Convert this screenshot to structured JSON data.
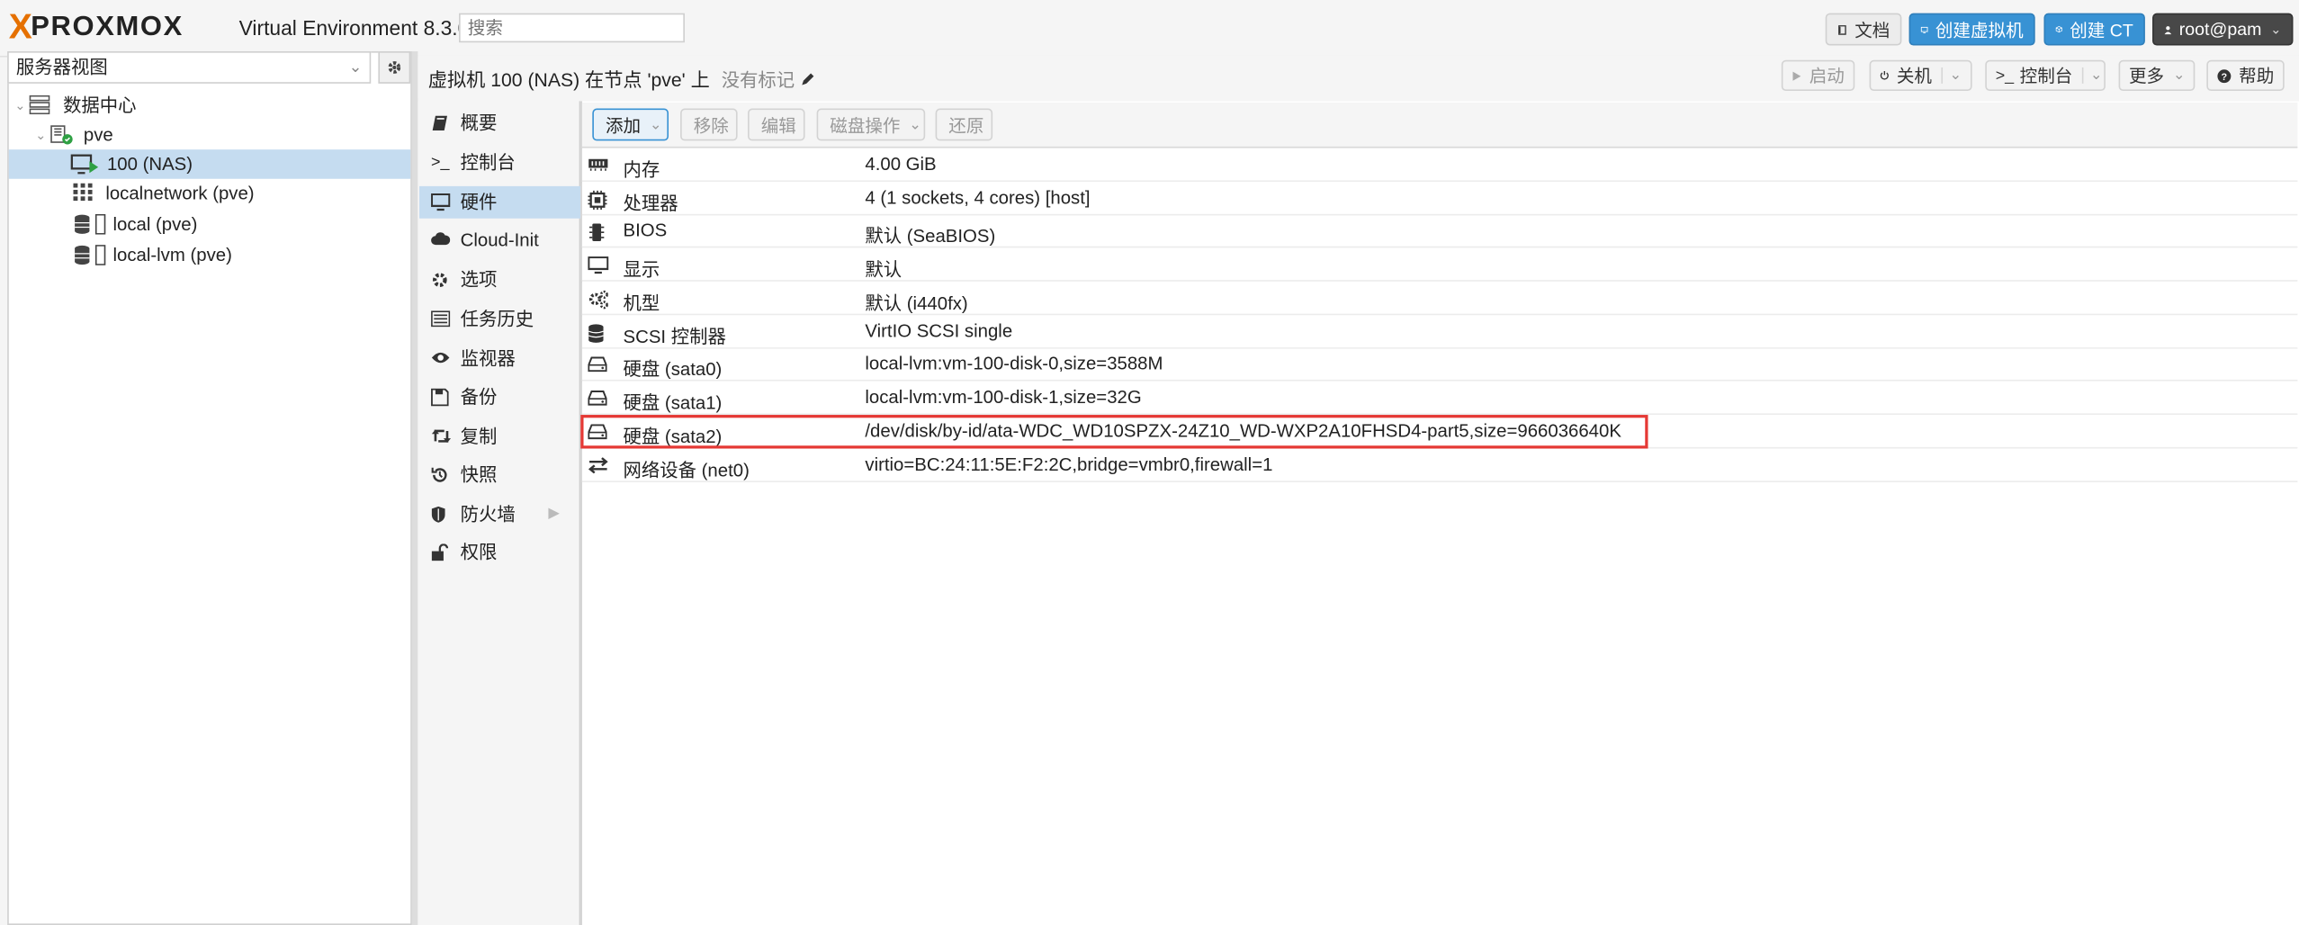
{
  "header": {
    "logo_text": "PROXMOX",
    "version": "Virtual Environment 8.3.0",
    "search_placeholder": "搜索",
    "docs_label": "文档",
    "create_vm_label": "创建虚拟机",
    "create_ct_label": "创建 CT",
    "user_label": "root@pam"
  },
  "sidebar": {
    "view_select": "服务器视图",
    "tree": [
      {
        "label": "数据中心",
        "icon": "server-stack-icon"
      },
      {
        "label": "pve",
        "icon": "node-icon"
      },
      {
        "label": "100 (NAS)",
        "icon": "vm-running-icon",
        "selected": true
      },
      {
        "label": "localnetwork (pve)",
        "icon": "grid-icon"
      },
      {
        "label": "local (pve)",
        "icon": "storage-icon"
      },
      {
        "label": "local-lvm (pve)",
        "icon": "storage-icon"
      }
    ]
  },
  "content_header": {
    "title": "虚拟机 100 (NAS) 在节点 'pve' 上",
    "tags_label": "没有标记",
    "start_label": "启动",
    "shutdown_label": "关机",
    "console_label": "控制台",
    "more_label": "更多",
    "help_label": "帮助"
  },
  "subnav": {
    "items": [
      {
        "label": "概要",
        "icon": "book-icon"
      },
      {
        "label": "控制台",
        "icon": "terminal-icon"
      },
      {
        "label": "硬件",
        "icon": "desktop-icon",
        "selected": true
      },
      {
        "label": "Cloud-Init",
        "icon": "cloud-icon"
      },
      {
        "label": "选项",
        "icon": "gear-icon"
      },
      {
        "label": "任务历史",
        "icon": "list-icon"
      },
      {
        "label": "监视器",
        "icon": "eye-icon"
      },
      {
        "label": "备份",
        "icon": "floppy-icon"
      },
      {
        "label": "复制",
        "icon": "retweet-icon"
      },
      {
        "label": "快照",
        "icon": "history-icon"
      },
      {
        "label": "防火墙",
        "icon": "shield-icon"
      },
      {
        "label": "权限",
        "icon": "unlock-icon"
      }
    ]
  },
  "toolbar": {
    "add_label": "添加",
    "remove_label": "移除",
    "edit_label": "编辑",
    "disk_action_label": "磁盘操作",
    "revert_label": "还原"
  },
  "hardware": {
    "rows": [
      {
        "key": "内存",
        "value": "4.00 GiB",
        "icon": "memory-icon"
      },
      {
        "key": "处理器",
        "value": "4 (1 sockets, 4 cores) [host]",
        "icon": "cpu-icon"
      },
      {
        "key": "BIOS",
        "value": "默认 (SeaBIOS)",
        "icon": "microchip-icon"
      },
      {
        "key": "显示",
        "value": "默认",
        "icon": "desktop-icon"
      },
      {
        "key": "机型",
        "value": "默认 (i440fx)",
        "icon": "gears-icon"
      },
      {
        "key": "SCSI 控制器",
        "value": "VirtIO SCSI single",
        "icon": "database-icon"
      },
      {
        "key": "硬盘 (sata0)",
        "value": "local-lvm:vm-100-disk-0,size=3588M",
        "icon": "hdd-icon"
      },
      {
        "key": "硬盘 (sata1)",
        "value": "local-lvm:vm-100-disk-1,size=32G",
        "icon": "hdd-icon"
      },
      {
        "key": "硬盘 (sata2)",
        "value": "/dev/disk/by-id/ata-WDC_WD10SPZX-24Z10_WD-WXP2A10FHSD4-part5,size=966036640K",
        "icon": "hdd-icon",
        "highlighted": true
      },
      {
        "key": "网络设备 (net0)",
        "value": "virtio=BC:24:11:5E:F2:2C,bridge=vmbr0,firewall=1",
        "icon": "exchange-icon"
      }
    ]
  },
  "colors": {
    "accent": "#3892d4",
    "selection": "#c5dcf0",
    "highlight_border": "#e53935",
    "logo_orange": "#e57000"
  }
}
